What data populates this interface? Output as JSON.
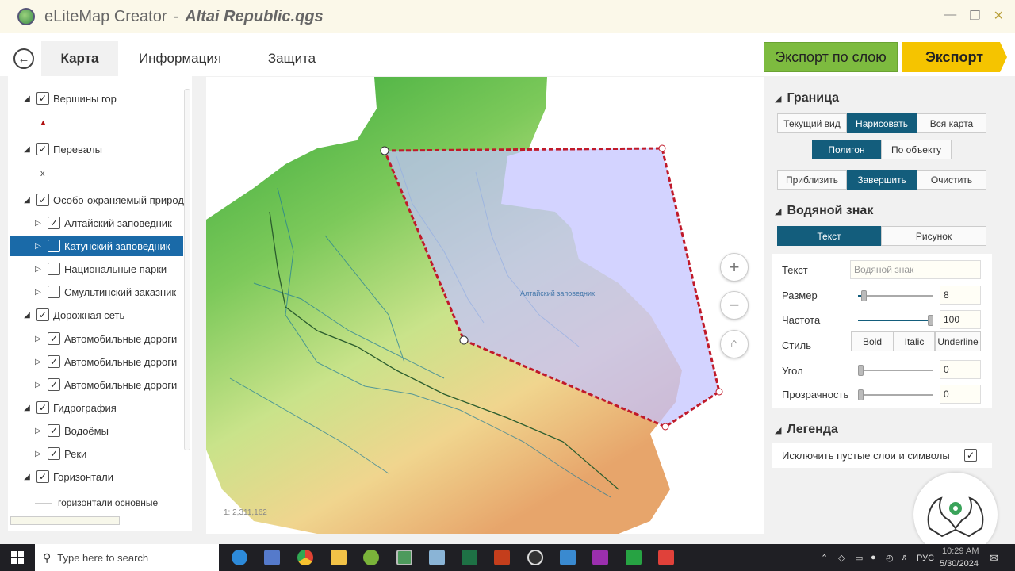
{
  "app": {
    "name": "eLiteMap Creator",
    "sep": "-",
    "file": "Altai Republic.qgs"
  },
  "nav": {
    "tabs": [
      "Карта",
      "Информация",
      "Защита"
    ],
    "export_layer": "Экспорт по слою",
    "export": "Экспорт"
  },
  "layers": [
    {
      "label": "Вершины гор",
      "checked": true,
      "expanded": true,
      "indent": 0
    },
    {
      "label": "Перевалы",
      "checked": true,
      "expanded": true,
      "indent": 0
    },
    {
      "label": "Особо-охраняемый природ",
      "checked": true,
      "expanded": true,
      "indent": 0
    },
    {
      "label": "Алтайский заповедник",
      "checked": true,
      "expanded": false,
      "indent": 1
    },
    {
      "label": "Катунский заповедник",
      "checked": false,
      "expanded": false,
      "indent": 1,
      "selected": true
    },
    {
      "label": "Национальные парки",
      "checked": false,
      "expanded": false,
      "indent": 1
    },
    {
      "label": "Смультинский заказник",
      "checked": false,
      "expanded": false,
      "indent": 1
    },
    {
      "label": "Дорожная сеть",
      "checked": true,
      "expanded": true,
      "indent": 0
    },
    {
      "label": "Автомобильные дороги",
      "checked": true,
      "expanded": false,
      "indent": 1
    },
    {
      "label": "Автомобильные дороги",
      "checked": true,
      "expanded": false,
      "indent": 1
    },
    {
      "label": "Автомобильные дороги",
      "checked": true,
      "expanded": false,
      "indent": 1
    },
    {
      "label": "Гидрография",
      "checked": true,
      "expanded": true,
      "indent": 0
    },
    {
      "label": "Водоёмы",
      "checked": true,
      "expanded": false,
      "indent": 1
    },
    {
      "label": "Реки",
      "checked": true,
      "expanded": false,
      "indent": 1
    },
    {
      "label": "Горизонтали",
      "checked": true,
      "expanded": true,
      "indent": 0
    }
  ],
  "layer_symbols": {
    "peaks": "▲",
    "passes": "x",
    "contours": "горизонтали основные"
  },
  "map": {
    "scale": "1: 2,311,162",
    "reserve_label": "Алтайский заповедник"
  },
  "border": {
    "title": "Граница",
    "modes": [
      "Текущий вид",
      "Нарисовать",
      "Вся карта"
    ],
    "types": [
      "Полигон",
      "По объекту"
    ],
    "actions": [
      "Приблизить",
      "Завершить",
      "Очистить"
    ]
  },
  "watermark": {
    "title": "Водяной знак",
    "tabs": [
      "Текст",
      "Рисунок"
    ],
    "text_label": "Текст",
    "text_placeholder": "Водяной знак",
    "size_label": "Размер",
    "size_value": "8",
    "size_fraction": 0.07,
    "freq_label": "Частота",
    "freq_value": "100",
    "freq_fraction": 1.0,
    "style_label": "Стиль",
    "styles": [
      "Bold",
      "Italic",
      "Underline"
    ],
    "angle_label": "Угол",
    "angle_value": "0",
    "angle_fraction": 0,
    "opacity_label": "Прозрачность",
    "opacity_value": "0",
    "opacity_fraction": 0
  },
  "legend": {
    "title": "Легенда",
    "option": "Исключить пустые слои и символы",
    "checked": true
  },
  "taskbar": {
    "search": "Type here to search",
    "lang": "РУС",
    "time": "10:29 AM",
    "date": "5/30/2024"
  },
  "colors": {
    "accent": "#135d7c",
    "export_green": "#7dbb3f",
    "export_yellow": "#f5c400",
    "selection": "#1a6aa8"
  }
}
